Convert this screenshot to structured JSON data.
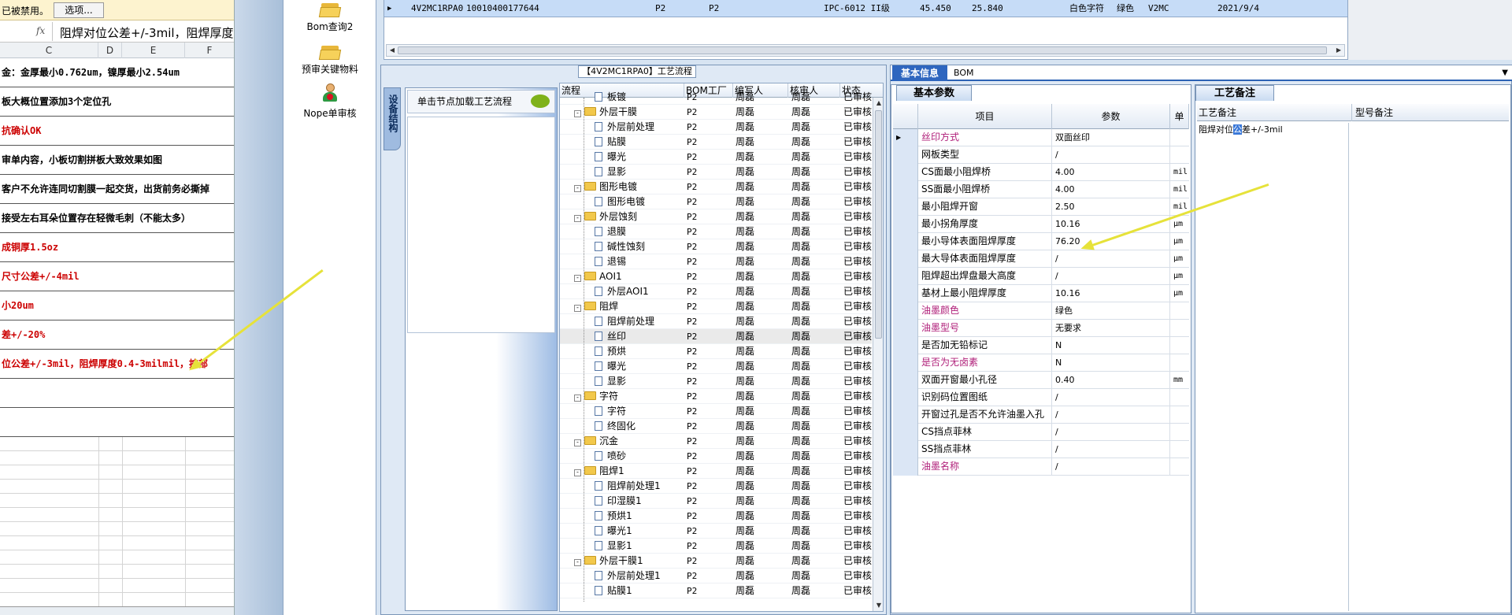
{
  "excel": {
    "warning_text": "已被禁用。",
    "options_button": "选项...",
    "fx_label": "fx",
    "formula_text": "阻焊对位公差+/-3mil，阻焊厚度",
    "columns": [
      "C",
      "D",
      "E",
      "F"
    ],
    "rows": [
      {
        "text": "金：金厚最小0.762um，镍厚最小2.54um",
        "red": false
      },
      {
        "text": "板大概位置添加3个定位孔",
        "red": false
      },
      {
        "text": "抗确认OK",
        "red": true
      },
      {
        "text": "审单内容，小板切割拼板大致效果如图",
        "red": false
      },
      {
        "text": "客户不允许连同切割膜一起交货，出货前务必撕掉",
        "red": false
      },
      {
        "text": "接受左右耳朵位置存在轻微毛刺（不能太多）",
        "red": false
      },
      {
        "text": "成铜厚1.5oz",
        "red": true
      },
      {
        "text": "尺寸公差+/-4mil",
        "red": true
      },
      {
        "text": "小20um",
        "red": true
      },
      {
        "text": "差+/-20%",
        "red": true
      },
      {
        "text": "位公差+/-3mil，阻焊厚度0.4-3milmil，按部",
        "red": true
      },
      {
        "text": "",
        "red": false
      },
      {
        "text": "",
        "red": false
      }
    ]
  },
  "nav": {
    "items": [
      {
        "label": "Bom查询2",
        "icon": "folder-icon"
      },
      {
        "label": "预审关键物料",
        "icon": "folder-icon"
      },
      {
        "label": "Nope单审核",
        "icon": "person-icon"
      }
    ]
  },
  "top_grid": {
    "row": [
      "4V2MC1RPA0",
      "10010400177644",
      "P2",
      "P2",
      "IPC-6012 II级",
      "45.450",
      "25.840",
      "白色字符",
      "绿色",
      "V2MC",
      "2021/9/4"
    ]
  },
  "flow": {
    "title": "【4V2MC1RPA0】工艺流程",
    "side_tab": "设备结构",
    "node_button": "单击节点加载工艺流程",
    "headers": [
      "流程",
      "BOM工厂",
      "编写人",
      "核审人",
      "状态"
    ],
    "rows": [
      {
        "name": "板镀",
        "level": 2,
        "factory": "P2",
        "writer": "周磊",
        "reviewer": "周磊",
        "status": "已审核"
      },
      {
        "name": "外层干膜",
        "level": 1,
        "factory": "P2",
        "writer": "周磊",
        "reviewer": "周磊",
        "status": "已审核"
      },
      {
        "name": "外层前处理",
        "level": 2,
        "factory": "P2",
        "writer": "周磊",
        "reviewer": "周磊",
        "status": "已审核"
      },
      {
        "name": "贴膜",
        "level": 2,
        "factory": "P2",
        "writer": "周磊",
        "reviewer": "周磊",
        "status": "已审核"
      },
      {
        "name": "曝光",
        "level": 2,
        "factory": "P2",
        "writer": "周磊",
        "reviewer": "周磊",
        "status": "已审核"
      },
      {
        "name": "显影",
        "level": 2,
        "factory": "P2",
        "writer": "周磊",
        "reviewer": "周磊",
        "status": "已审核"
      },
      {
        "name": "图形电镀",
        "level": 1,
        "factory": "P2",
        "writer": "周磊",
        "reviewer": "周磊",
        "status": "已审核"
      },
      {
        "name": "图形电镀",
        "level": 2,
        "factory": "P2",
        "writer": "周磊",
        "reviewer": "周磊",
        "status": "已审核"
      },
      {
        "name": "外层蚀刻",
        "level": 1,
        "factory": "P2",
        "writer": "周磊",
        "reviewer": "周磊",
        "status": "已审核"
      },
      {
        "name": "退膜",
        "level": 2,
        "factory": "P2",
        "writer": "周磊",
        "reviewer": "周磊",
        "status": "已审核"
      },
      {
        "name": "碱性蚀刻",
        "level": 2,
        "factory": "P2",
        "writer": "周磊",
        "reviewer": "周磊",
        "status": "已审核"
      },
      {
        "name": "退锡",
        "level": 2,
        "factory": "P2",
        "writer": "周磊",
        "reviewer": "周磊",
        "status": "已审核"
      },
      {
        "name": "AOI1",
        "level": 1,
        "factory": "P2",
        "writer": "周磊",
        "reviewer": "周磊",
        "status": "已审核"
      },
      {
        "name": "外层AOI1",
        "level": 2,
        "factory": "P2",
        "writer": "周磊",
        "reviewer": "周磊",
        "status": "已审核"
      },
      {
        "name": "阻焊",
        "level": 1,
        "factory": "P2",
        "writer": "周磊",
        "reviewer": "周磊",
        "status": "已审核"
      },
      {
        "name": "阻焊前处理",
        "level": 2,
        "factory": "P2",
        "writer": "周磊",
        "reviewer": "周磊",
        "status": "已审核"
      },
      {
        "name": "丝印",
        "level": 2,
        "factory": "P2",
        "writer": "周磊",
        "reviewer": "周磊",
        "status": "已审核",
        "selected": true
      },
      {
        "name": "预烘",
        "level": 2,
        "factory": "P2",
        "writer": "周磊",
        "reviewer": "周磊",
        "status": "已审核"
      },
      {
        "name": "曝光",
        "level": 2,
        "factory": "P2",
        "writer": "周磊",
        "reviewer": "周磊",
        "status": "已审核"
      },
      {
        "name": "显影",
        "level": 2,
        "factory": "P2",
        "writer": "周磊",
        "reviewer": "周磊",
        "status": "已审核"
      },
      {
        "name": "字符",
        "level": 1,
        "factory": "P2",
        "writer": "周磊",
        "reviewer": "周磊",
        "status": "已审核"
      },
      {
        "name": "字符",
        "level": 2,
        "factory": "P2",
        "writer": "周磊",
        "reviewer": "周磊",
        "status": "已审核"
      },
      {
        "name": "终固化",
        "level": 2,
        "factory": "P2",
        "writer": "周磊",
        "reviewer": "周磊",
        "status": "已审核"
      },
      {
        "name": "沉金",
        "level": 1,
        "factory": "P2",
        "writer": "周磊",
        "reviewer": "周磊",
        "status": "已审核"
      },
      {
        "name": "喷砂",
        "level": 2,
        "factory": "P2",
        "writer": "周磊",
        "reviewer": "周磊",
        "status": "已审核"
      },
      {
        "name": "阻焊1",
        "level": 1,
        "factory": "P2",
        "writer": "周磊",
        "reviewer": "周磊",
        "status": "已审核"
      },
      {
        "name": "阻焊前处理1",
        "level": 2,
        "factory": "P2",
        "writer": "周磊",
        "reviewer": "周磊",
        "status": "已审核"
      },
      {
        "name": "印湿膜1",
        "level": 2,
        "factory": "P2",
        "writer": "周磊",
        "reviewer": "周磊",
        "status": "已审核"
      },
      {
        "name": "预烘1",
        "level": 2,
        "factory": "P2",
        "writer": "周磊",
        "reviewer": "周磊",
        "status": "已审核"
      },
      {
        "name": "曝光1",
        "level": 2,
        "factory": "P2",
        "writer": "周磊",
        "reviewer": "周磊",
        "status": "已审核"
      },
      {
        "name": "显影1",
        "level": 2,
        "factory": "P2",
        "writer": "周磊",
        "reviewer": "周磊",
        "status": "已审核"
      },
      {
        "name": "外层干膜1",
        "level": 1,
        "factory": "P2",
        "writer": "周磊",
        "reviewer": "周磊",
        "status": "已审核"
      },
      {
        "name": "外层前处理1",
        "level": 2,
        "factory": "P2",
        "writer": "周磊",
        "reviewer": "周磊",
        "status": "已审核"
      },
      {
        "name": "贴膜1",
        "level": 2,
        "factory": "P2",
        "writer": "周磊",
        "reviewer": "周磊",
        "status": "已审核"
      }
    ]
  },
  "info": {
    "tabs": [
      "基本信息",
      "BOM"
    ],
    "basic_title": "基本参数",
    "headers": [
      "项目",
      "参数",
      "单"
    ],
    "rows": [
      {
        "item": "丝印方式",
        "value": "双面丝印",
        "unit": "",
        "pink": true
      },
      {
        "item": "网板类型",
        "value": "/",
        "unit": "",
        "pink": false
      },
      {
        "item": "CS面最小阻焊桥",
        "value": "4.00",
        "unit": "mil",
        "pink": false
      },
      {
        "item": "SS面最小阻焊桥",
        "value": "4.00",
        "unit": "mil",
        "pink": false
      },
      {
        "item": "最小阻焊开窗",
        "value": "2.50",
        "unit": "mil",
        "pink": false
      },
      {
        "item": "最小拐角厚度",
        "value": "10.16",
        "unit": "μm",
        "pink": false
      },
      {
        "item": "最小导体表面阻焊厚度",
        "value": "76.20",
        "unit": "μm",
        "pink": false
      },
      {
        "item": "最大导体表面阻焊厚度",
        "value": "/",
        "unit": "μm",
        "pink": false
      },
      {
        "item": "阻焊超出焊盘最大高度",
        "value": "/",
        "unit": "μm",
        "pink": false
      },
      {
        "item": "基材上最小阻焊厚度",
        "value": "10.16",
        "unit": "μm",
        "pink": false
      },
      {
        "item": "油墨颜色",
        "value": "绿色",
        "unit": "",
        "pink": true
      },
      {
        "item": "油墨型号",
        "value": "无要求",
        "unit": "",
        "pink": true
      },
      {
        "item": "是否加无铅标记",
        "value": "N",
        "unit": "",
        "pink": false
      },
      {
        "item": "是否为无卤素",
        "value": "N",
        "unit": "",
        "pink": true
      },
      {
        "item": "双面开窗最小孔径",
        "value": "0.40",
        "unit": "mm",
        "pink": false
      },
      {
        "item": "识别码位置图纸",
        "value": "/",
        "unit": "",
        "pink": false
      },
      {
        "item": "开窗过孔是否不允许油墨入孔",
        "value": "/",
        "unit": "",
        "pink": false
      },
      {
        "item": "CS挡点菲林",
        "value": "/",
        "unit": "",
        "pink": false
      },
      {
        "item": "SS挡点菲林",
        "value": "/",
        "unit": "",
        "pink": false
      },
      {
        "item": "油墨名称",
        "value": "/",
        "unit": "",
        "pink": true
      }
    ],
    "remark_title": "工艺备注",
    "remark_headers": [
      "工艺备注",
      "型号备注"
    ],
    "remark_pre": "阻焊对位",
    "remark_hl": "公",
    "remark_post": "差+/-3mil"
  },
  "colors": {
    "accent": "#2e66bf",
    "highlight_row": "#c6dcf7",
    "pink_label": "#b0207a",
    "red_text": "#cc0000",
    "arrow": "#e6e23a"
  }
}
